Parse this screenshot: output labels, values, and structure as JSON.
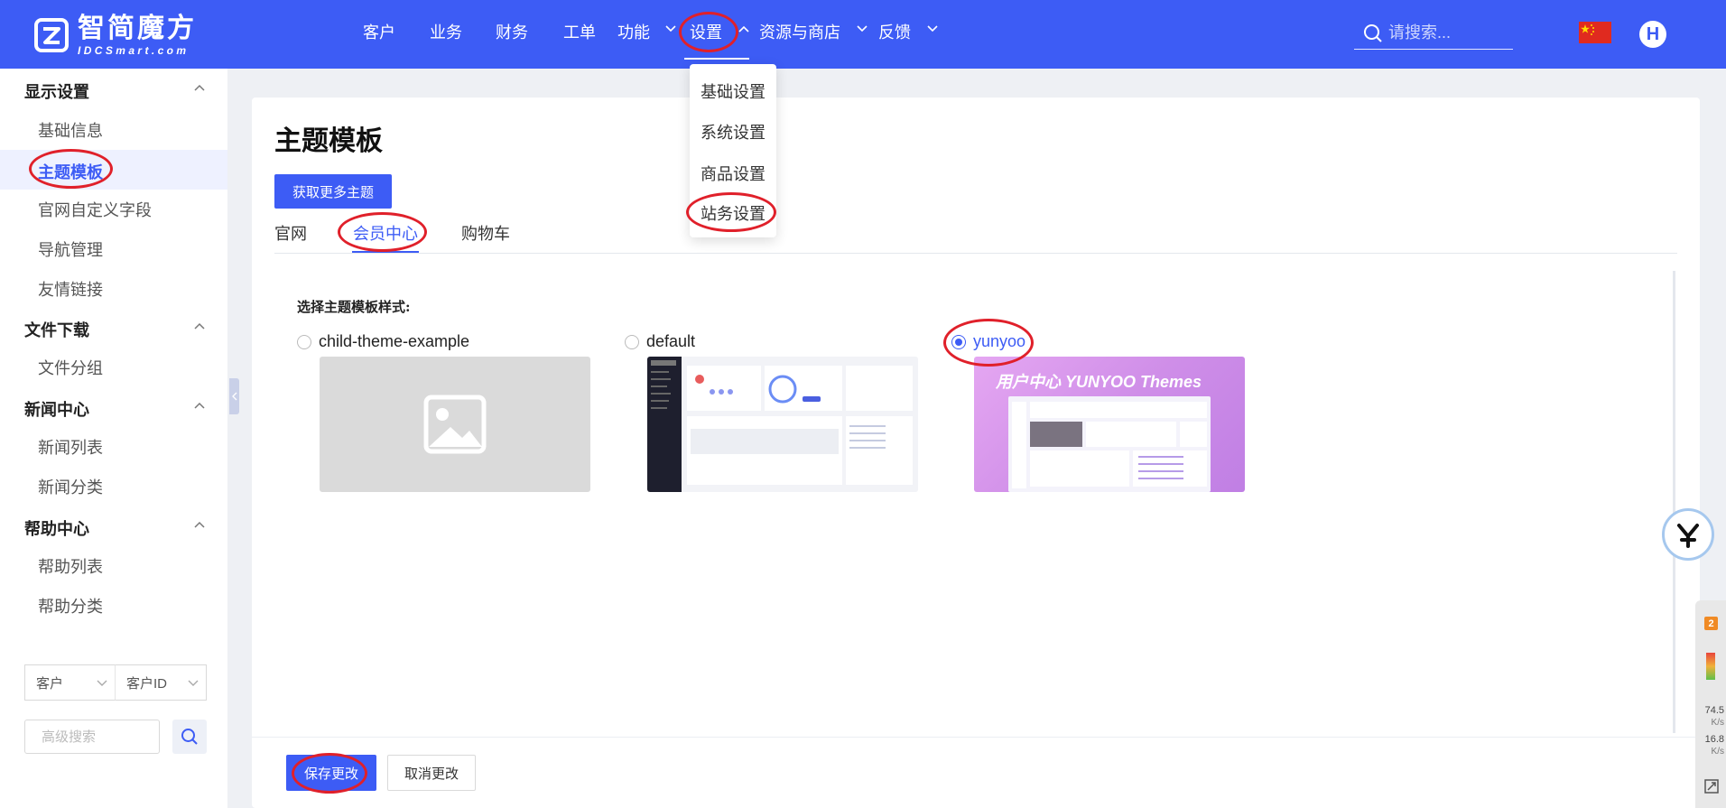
{
  "brand": {
    "name": "智简魔方",
    "sub": "IDCSmart.com"
  },
  "nav": {
    "items": [
      "客户",
      "业务",
      "财务",
      "工单",
      "功能",
      "设置",
      "资源与商店",
      "反馈"
    ],
    "search_placeholder": "请搜索...",
    "avatar_initial": "H"
  },
  "dropdown": {
    "items": [
      "基础设置",
      "系统设置",
      "商品设置",
      "站务设置"
    ]
  },
  "sidebar": {
    "groups": [
      {
        "title": "显示设置",
        "items": [
          "基础信息",
          "主题模板",
          "官网自定义字段",
          "导航管理",
          "友情链接"
        ]
      },
      {
        "title": "文件下载",
        "items": [
          "文件分组"
        ]
      },
      {
        "title": "新闻中心",
        "items": [
          "新闻列表",
          "新闻分类"
        ]
      },
      {
        "title": "帮助中心",
        "items": [
          "帮助列表",
          "帮助分类"
        ]
      }
    ],
    "active_item": "主题模板",
    "filter": {
      "select1": "客户",
      "select2": "客户ID",
      "search_placeholder": "高级搜索"
    }
  },
  "main": {
    "title": "主题模板",
    "get_more_button": "获取更多主题",
    "tabs": [
      "官网",
      "会员中心",
      "购物车"
    ],
    "active_tab": "会员中心",
    "section_label": "选择主题模板样式:",
    "themes": [
      {
        "name": "child-theme-example",
        "checked": false
      },
      {
        "name": "default",
        "checked": false
      },
      {
        "name": "yunyoo",
        "checked": true,
        "thumb_caption": "用户中心  YUNYOO Themes"
      }
    ],
    "save_button": "保存更改",
    "cancel_button": "取消更改"
  },
  "monitor": {
    "badge": "2",
    "upload": "74.5",
    "upload_unit": "K/s",
    "download": "16.8",
    "download_unit": "K/s"
  },
  "colors": {
    "primary": "#3d5cf5",
    "annotation": "#e0202a"
  }
}
